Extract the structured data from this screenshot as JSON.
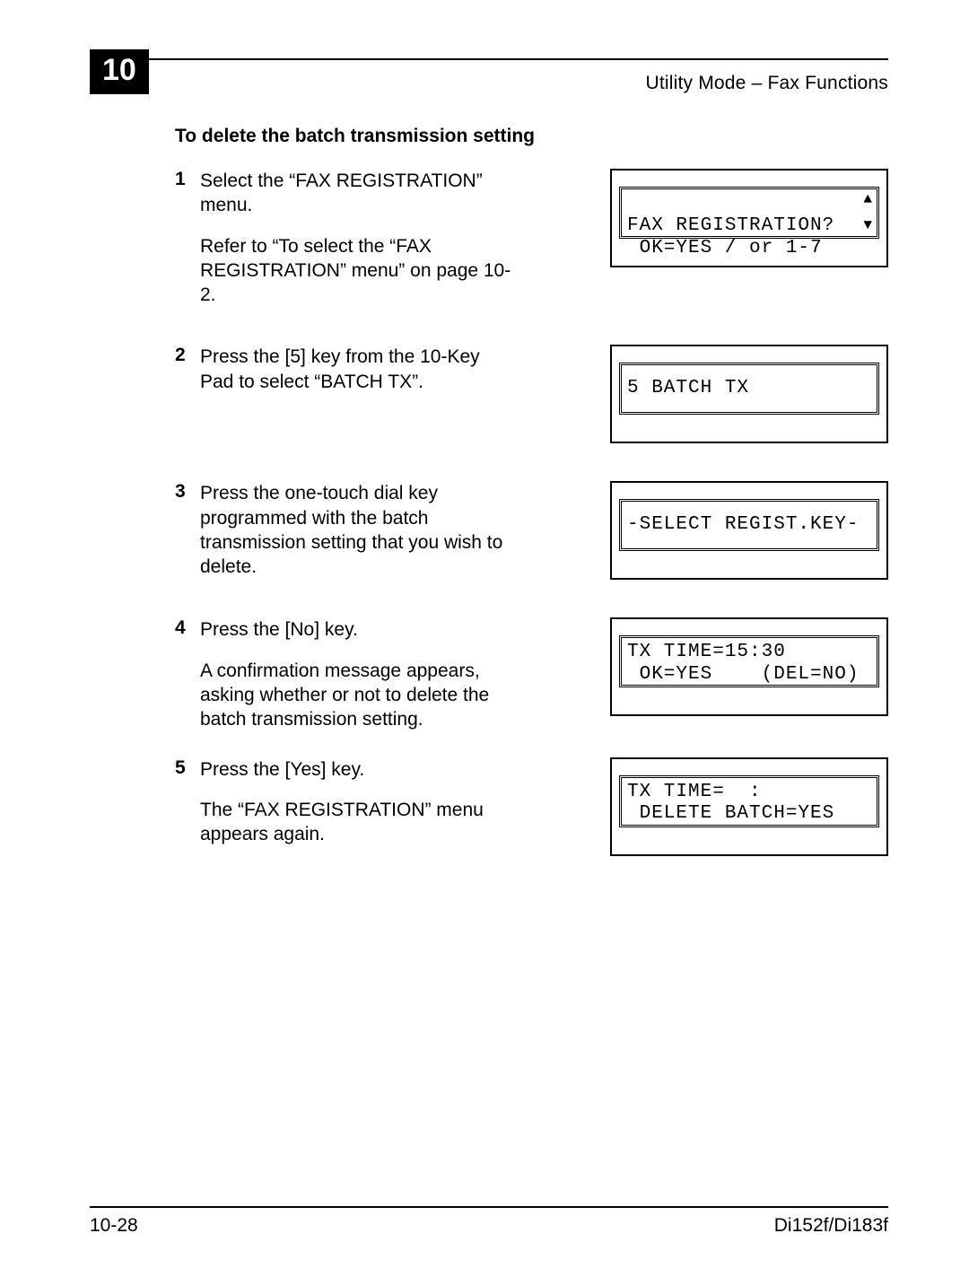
{
  "header": {
    "chapter_number": "10",
    "title": "Utility Mode – Fax Functions"
  },
  "section_title": "To delete the batch transmission setting",
  "steps": [
    {
      "num": "1",
      "text": "Select the “FAX REGISTRATION” menu.",
      "sub": "Refer to “To select the “FAX REGISTRATION” menu” on page 10-2.",
      "lcd": {
        "line1": "FAX REGISTRATION?",
        "line2": " OK=YES / or 1-7",
        "arrows": true
      }
    },
    {
      "num": "2",
      "text": "Press the [5] key from the 10-Key Pad to select “BATCH TX”.",
      "lcd": {
        "line1": "5 BATCH TX",
        "single": true
      }
    },
    {
      "num": "3",
      "text": "Press the one-touch dial key programmed with the batch transmission setting that you wish to delete.",
      "lcd": {
        "line1": "-SELECT REGIST.KEY-",
        "single": true
      }
    },
    {
      "num": "4",
      "text": "Press the [No] key.",
      "sub": "A confirmation message appears, asking whether or not to delete the batch transmission setting.",
      "lcd": {
        "line1": "TX TIME=15:30",
        "line2": " OK=YES    (DEL=NO)"
      }
    },
    {
      "num": "5",
      "text": "Press the [Yes] key.",
      "sub": "The “FAX REGISTRATION” menu appears again.",
      "lcd": {
        "line1": "TX TIME=  :",
        "line2": " DELETE BATCH=YES"
      }
    }
  ],
  "footer": {
    "left": "10-28",
    "right": "Di152f/Di183f"
  },
  "glyphs": {
    "up": "▲",
    "down": "▼"
  }
}
